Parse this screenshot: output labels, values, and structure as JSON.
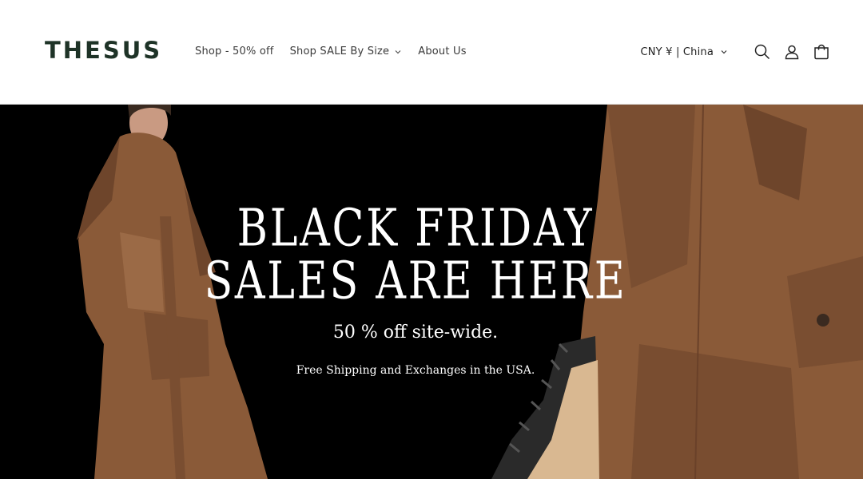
{
  "brand": {
    "logo_text": "THESUS"
  },
  "nav": {
    "items": [
      {
        "label": "Shop - 50% off",
        "has_dropdown": false
      },
      {
        "label": "Shop SALE By Size",
        "has_dropdown": true
      },
      {
        "label": "About Us",
        "has_dropdown": false
      }
    ]
  },
  "tools": {
    "country_selector": "CNY ¥ | China",
    "icons": [
      "search-icon",
      "account-icon",
      "cart-icon"
    ]
  },
  "hero": {
    "headline_line_1": "BLACK FRIDAY",
    "headline_line_2": "SALES ARE HERE",
    "subheadline": "50 % off site-wide.",
    "note": "Free Shipping and Exchanges in the USA."
  },
  "colors": {
    "logo": "#1e3327",
    "hero_background": "#000000",
    "coat_brown": "#8a5a38",
    "text_white": "#ffffff"
  }
}
